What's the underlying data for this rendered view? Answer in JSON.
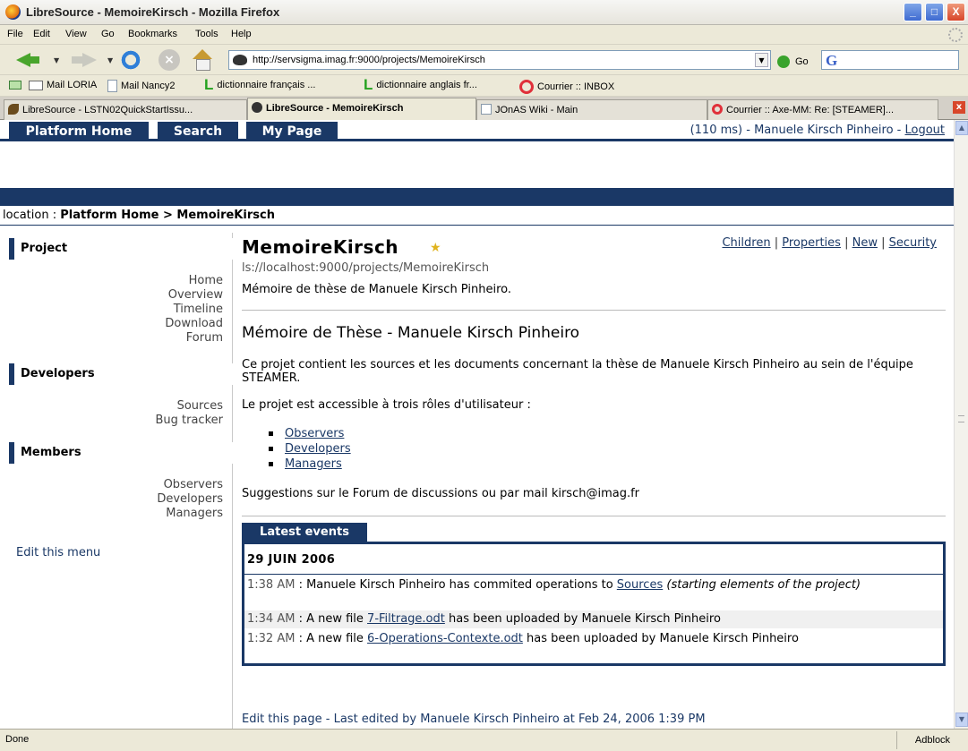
{
  "window": {
    "title": "LibreSource - MemoireKirsch - Mozilla Firefox",
    "min_glyph": "_",
    "max_glyph": "□",
    "close_glyph": "X"
  },
  "menubar": [
    "File",
    "Edit",
    "View",
    "Go",
    "Bookmarks",
    "Tools",
    "Help"
  ],
  "navbar": {
    "url": "http://servsigma.imag.fr:9000/projects/MemoireKirsch",
    "go_label": "Go",
    "search_engine_glyph": "G"
  },
  "bookmarks": [
    {
      "label": "Mail LORIA",
      "icon": "mail-icon"
    },
    {
      "label": "Mail Nancy2",
      "icon": "page-icon"
    },
    {
      "label": "dictionnaire français ...",
      "icon": "leo-icon"
    },
    {
      "label": "dictionnaire anglais fr...",
      "icon": "leo-icon"
    },
    {
      "label": "Courrier :: INBOX",
      "icon": "courrier-icon"
    }
  ],
  "tabs": [
    {
      "label": "LibreSource - LSTN02QuickStartIssu...",
      "active": false
    },
    {
      "label": "LibreSource - MemoireKirsch",
      "active": true
    },
    {
      "label": "JOnAS Wiki - Main",
      "active": false
    },
    {
      "label": "Courrier :: Axe-MM: Re: [STEAMER]...",
      "active": false
    }
  ],
  "platform_nav": {
    "home": "Platform Home",
    "search": "Search",
    "mypage": "My Page",
    "user_prefix": "(110 ms) - Manuele Kirsch Pinheiro - ",
    "logout": "Logout"
  },
  "location": {
    "prefix": "location : ",
    "path": "Platform Home > MemoireKirsch"
  },
  "side_menu": {
    "sections": [
      {
        "title": "Project",
        "items": [
          "Home",
          "Overview",
          "Timeline",
          "Download",
          "Forum"
        ]
      },
      {
        "title": "Developers",
        "items": [
          "Sources",
          "Bug tracker"
        ]
      },
      {
        "title": "Members",
        "items": [
          "Observers",
          "Developers",
          "Managers"
        ]
      }
    ],
    "edit_menu": "Edit this menu"
  },
  "main": {
    "title": "MemoireKirsch",
    "actions": [
      "Children",
      "Properties",
      "New",
      "Security"
    ],
    "ls_url": "ls://localhost:9000/projects/MemoireKirsch",
    "description": "Mémoire de thèse de Manuele Kirsch Pinheiro.",
    "heading": "Mémoire de Thèse - Manuele Kirsch Pinheiro",
    "para1": "Ce projet contient les sources et les documents concernant la thèse de Manuele Kirsch Pinheiro au sein de l'équipe STEAMER.",
    "para2": "Le projet est accessible à trois rôles d'utilisateur :",
    "roles": [
      "Observers",
      "Developers",
      "Managers"
    ],
    "para3": "Suggestions sur le Forum de discussions ou par mail kirsch@imag.fr"
  },
  "events": {
    "tab_label": "Latest events",
    "date": "29 JUIN 2006",
    "rows": [
      {
        "time": "1:38 AM",
        "pre": " : Manuele Kirsch Pinheiro has commited operations to ",
        "link": "Sources",
        "post": "",
        "italic": "(starting elements of the project)"
      },
      {
        "time": "1:34 AM",
        "pre": " : A new file ",
        "link": "7-Filtrage.odt",
        "post": " has been uploaded by Manuele Kirsch Pinheiro",
        "italic": ""
      },
      {
        "time": "1:32 AM",
        "pre": " : A new file ",
        "link": "6-Operations-Contexte.odt",
        "post": " has been uploaded by Manuele Kirsch Pinheiro",
        "italic": ""
      }
    ]
  },
  "edit_page": "Edit this page - Last edited by Manuele Kirsch Pinheiro at Feb 24, 2006 1:39 PM",
  "status": {
    "text": "Done",
    "adblock": "Adblock"
  }
}
